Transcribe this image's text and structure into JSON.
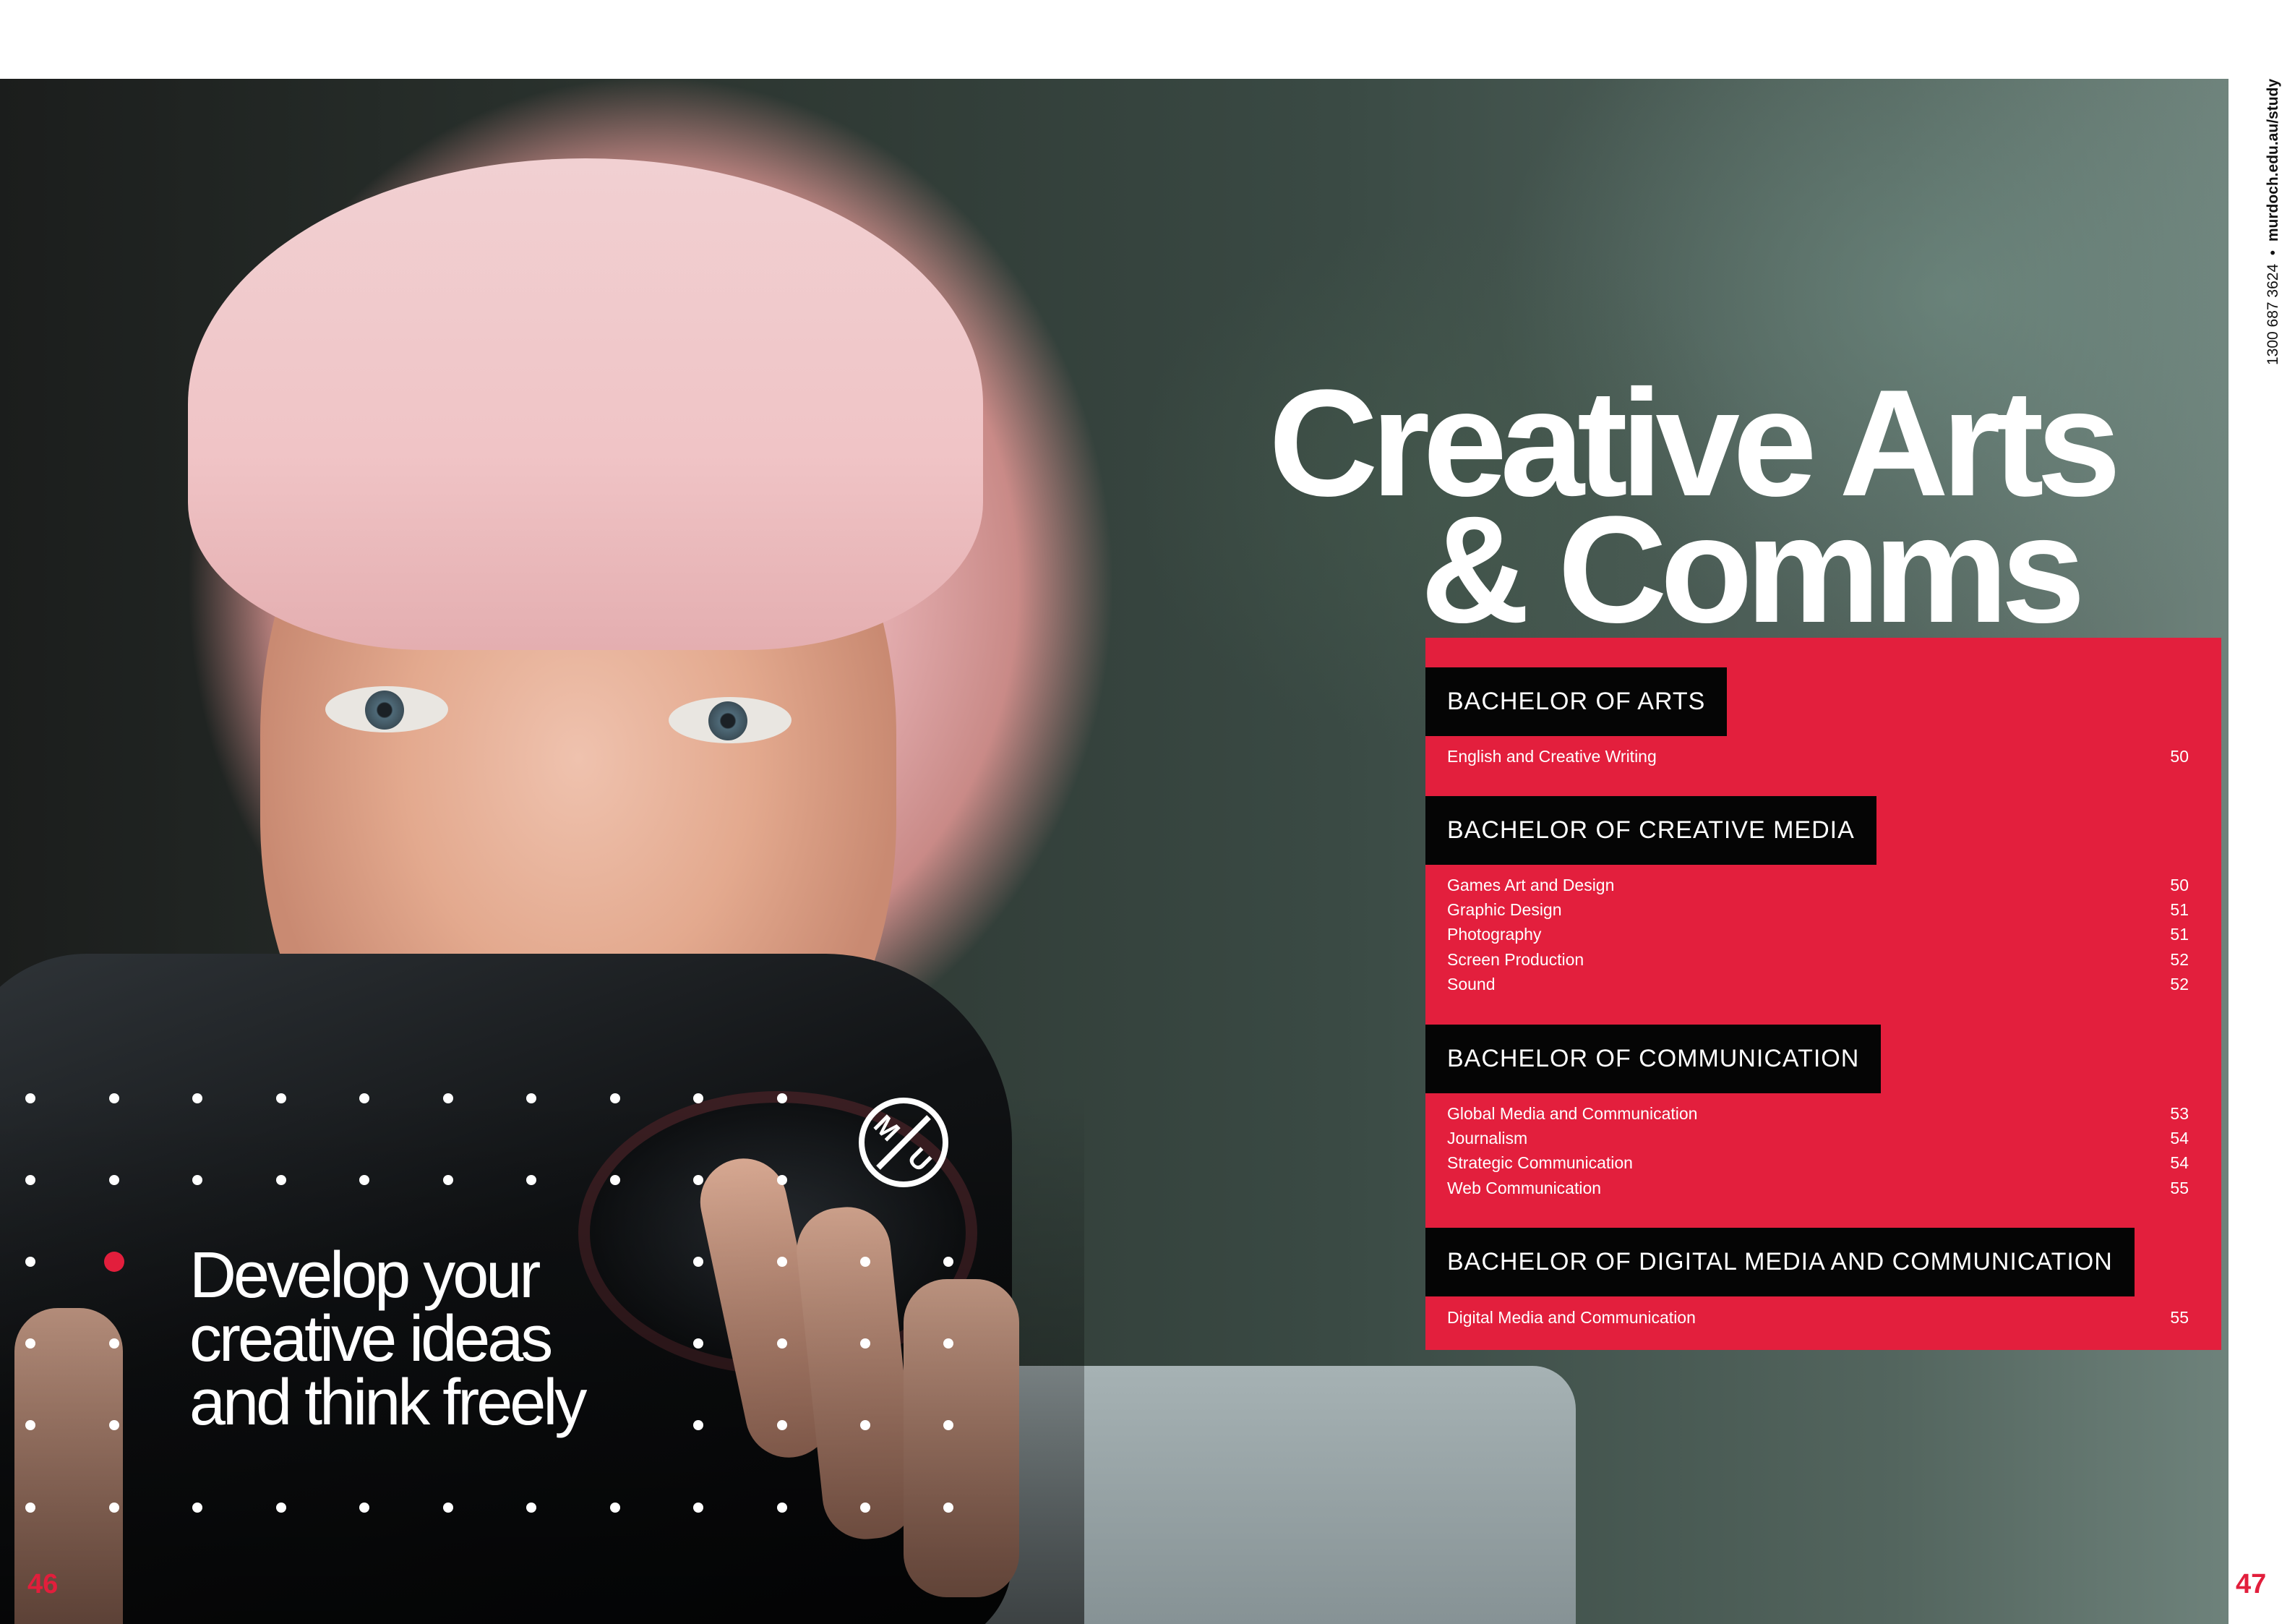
{
  "heading": {
    "line1": "Creative Arts",
    "line2": "& Comms"
  },
  "tagline": {
    "line1": "Develop your",
    "line2": "creative ideas",
    "line3": "and think freely"
  },
  "logo": {
    "name": "murdoch-university-monogram",
    "letters": "MU"
  },
  "contact": {
    "phone": "1300 687 3624",
    "separator": "•",
    "website": "murdoch.edu.au/study"
  },
  "pages": {
    "left": "46",
    "right": "47"
  },
  "colors": {
    "accent": "#e31f3d",
    "label_bg": "#050505",
    "text": "#ffffff"
  },
  "degrees": [
    {
      "title": "BACHELOR OF ARTS",
      "courses": [
        {
          "name": "English and Creative Writing",
          "page": "50"
        }
      ]
    },
    {
      "title": "BACHELOR OF CREATIVE MEDIA",
      "courses": [
        {
          "name": "Games Art and Design",
          "page": "50"
        },
        {
          "name": "Graphic Design",
          "page": "51"
        },
        {
          "name": "Photography",
          "page": "51"
        },
        {
          "name": "Screen Production",
          "page": "52"
        },
        {
          "name": "Sound",
          "page": "52"
        }
      ]
    },
    {
      "title": "BACHELOR OF COMMUNICATION",
      "courses": [
        {
          "name": "Global Media and Communication",
          "page": "53"
        },
        {
          "name": "Journalism",
          "page": "54"
        },
        {
          "name": "Strategic Communication",
          "page": "54"
        },
        {
          "name": "Web Communication",
          "page": "55"
        }
      ]
    },
    {
      "title": "BACHELOR OF DIGITAL MEDIA AND COMMUNICATION",
      "courses": [
        {
          "name": "Digital Media and Communication",
          "page": "55"
        }
      ]
    }
  ]
}
